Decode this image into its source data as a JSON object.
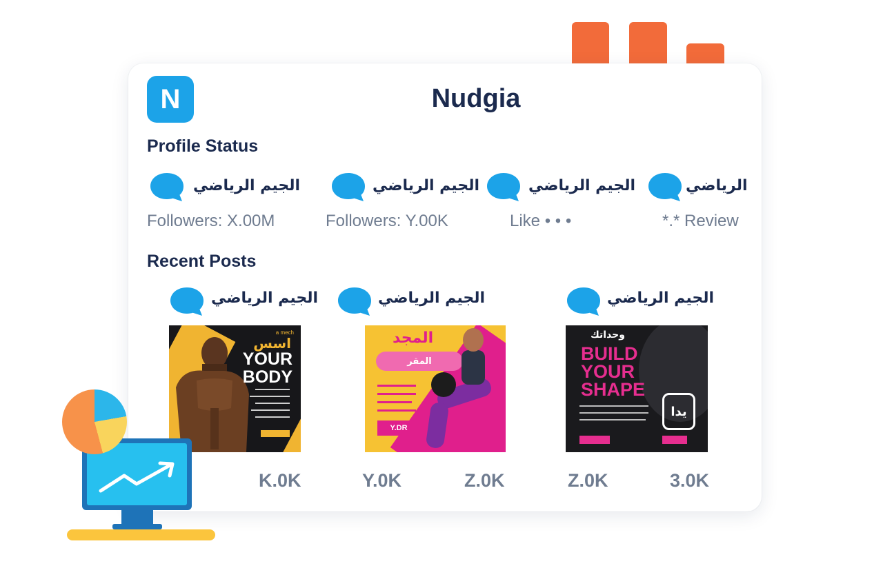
{
  "app": {
    "logo_letter": "N",
    "title": "Nudgia"
  },
  "sections": {
    "profile_status": "Profile Status",
    "recent_posts": "Recent Posts"
  },
  "profiles": [
    {
      "name": "الجيم الرياضي",
      "stat": "Followers: X.00M"
    },
    {
      "name": "الجيم الرياضي",
      "stat": "Followers: Y.00K"
    },
    {
      "name": "الجيم الرياضي",
      "stat": "Like • • •"
    },
    {
      "name": "الرياضي",
      "stat": "*.* Review"
    }
  ],
  "posts": [
    {
      "name": "الجيم الرياضي",
      "image": {
        "brand": "a mech",
        "ar_title": "اسس",
        "headline_1": "YOUR",
        "headline_2": "BODY"
      },
      "metrics": [
        "K.0K"
      ]
    },
    {
      "name": "الجيم الرياضي",
      "image": {
        "ar_title": "المجد",
        "pill_text": "المقر",
        "price_tag": "Y.DR"
      },
      "metrics": [
        "Y.0K",
        "Z.0K"
      ]
    },
    {
      "name": "الجيم الرياضي",
      "image": {
        "ar_title": "وحداتك",
        "headline_1": "BUILD",
        "headline_2": "YOUR",
        "headline_3": "SHAPE",
        "badge": "يدا"
      },
      "metrics": [
        "Z.0K",
        "3.0K"
      ]
    }
  ],
  "colors": {
    "accent_blue": "#1ca3e8",
    "title_navy": "#1b2a4e",
    "muted_gray": "#6f7c90",
    "orange": "#f26b3a",
    "gold": "#f0b431",
    "magenta": "#e62e8f"
  }
}
